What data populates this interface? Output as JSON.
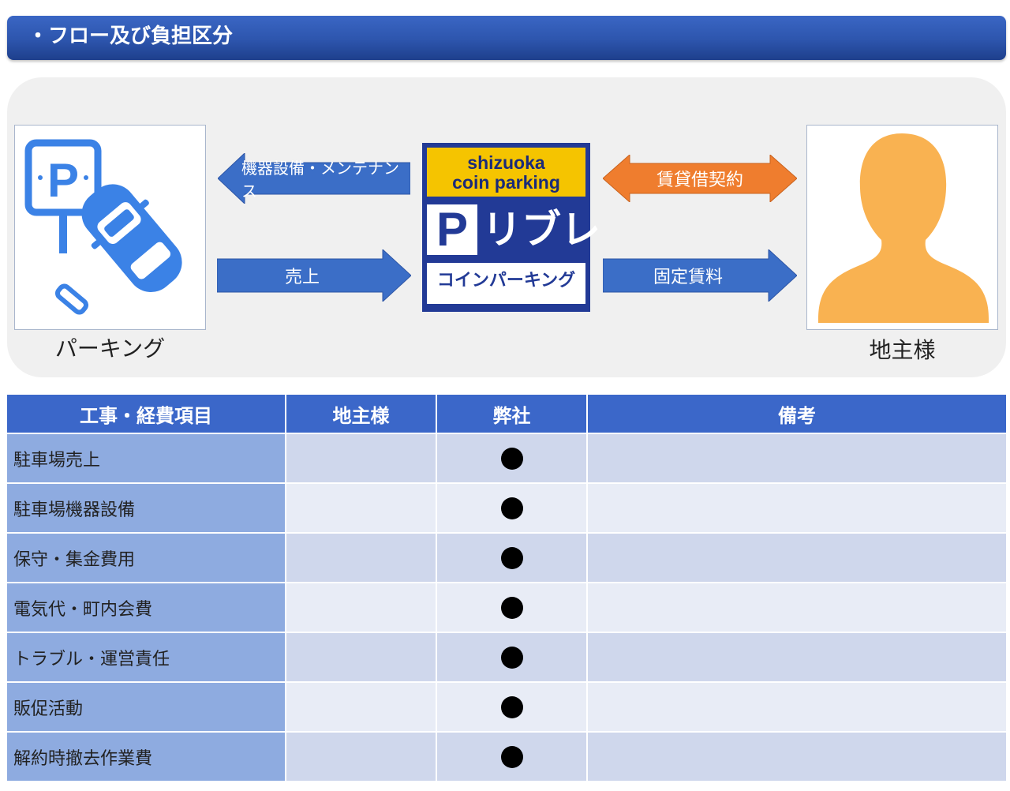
{
  "header": {
    "title": "・フロー及び負担区分"
  },
  "flow": {
    "parking_caption": "パーキング",
    "landowner_caption": "地主様",
    "arrows": {
      "equipment": "機器設備・メンテナンス",
      "sales": "売上",
      "lease_contract": "賃貸借契約",
      "fixed_rent": "固定賃料"
    },
    "parking_sign_letter": "P",
    "logo": {
      "line1": "shizuoka",
      "line2": "coin parking",
      "p_letter": "P",
      "brand": "リブレ",
      "subtitle": "コインパーキング"
    },
    "colors": {
      "blue_arrow": "#3b6ec7",
      "orange_arrow": "#ef7d2e",
      "person": "#f9b251",
      "icon_blue": "#3b82e6"
    }
  },
  "table": {
    "headers": [
      "工事・経費項目",
      "地主様",
      "弊社",
      "備考"
    ],
    "rows": [
      {
        "item": "駐車場売上",
        "landowner": "",
        "company": "●",
        "note": ""
      },
      {
        "item": "駐車場機器設備",
        "landowner": "",
        "company": "●",
        "note": ""
      },
      {
        "item": "保守・集金費用",
        "landowner": "",
        "company": "●",
        "note": ""
      },
      {
        "item": "電気代・町内会費",
        "landowner": "",
        "company": "●",
        "note": ""
      },
      {
        "item": "トラブル・運営責任",
        "landowner": "",
        "company": "●",
        "note": ""
      },
      {
        "item": "販促活動",
        "landowner": "",
        "company": "●",
        "note": ""
      },
      {
        "item": "解約時撤去作業費",
        "landowner": "",
        "company": "●",
        "note": ""
      }
    ]
  }
}
